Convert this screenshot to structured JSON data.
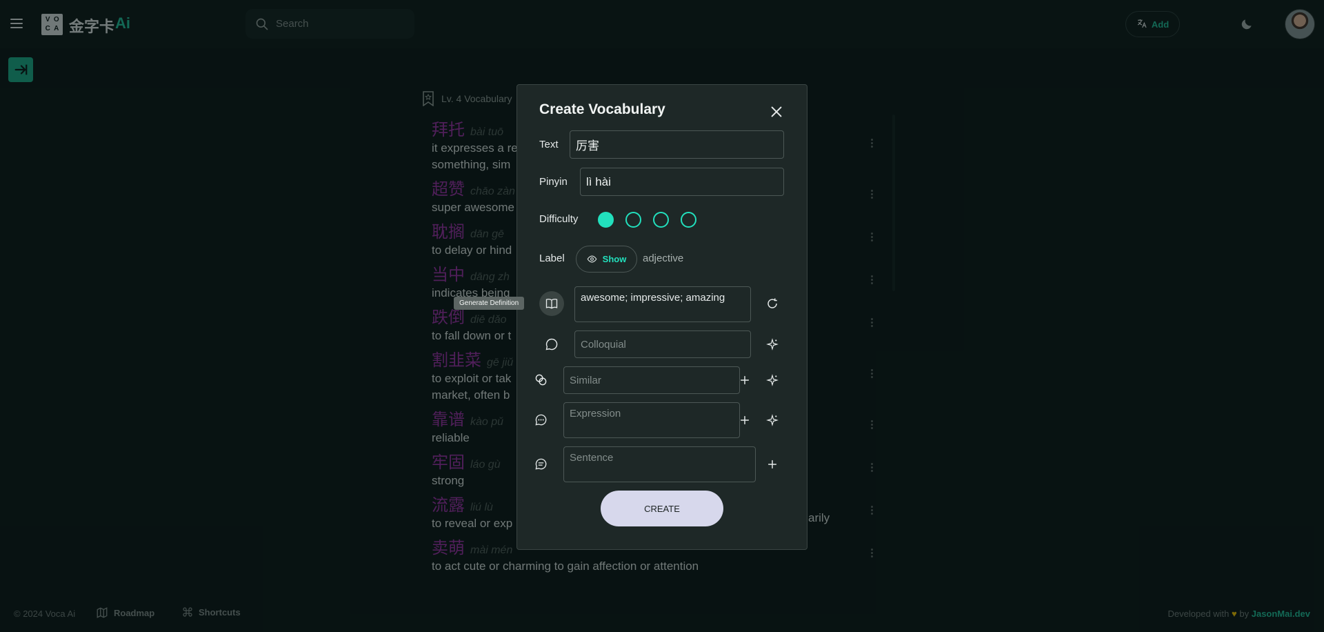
{
  "app": {
    "logo_letters": [
      "V",
      "O",
      "C",
      "A"
    ],
    "name": "金字卡",
    "name_suffix": "Ai"
  },
  "search": {
    "placeholder": "Search"
  },
  "header": {
    "add_label": "Add"
  },
  "level": {
    "label": "Lv. 4 Vocabulary"
  },
  "vocab": [
    {
      "hanzi": "拜托",
      "pinyin": "bài tuō",
      "definition": "it expresses a re",
      "definition2": "something, sim"
    },
    {
      "hanzi": "超赞",
      "pinyin": "chāo zàn",
      "definition": "super awesome"
    },
    {
      "hanzi": "耽搁",
      "pinyin": "dān gē",
      "definition": "to delay or hind"
    },
    {
      "hanzi": "当中",
      "pinyin": "dāng zh",
      "definition": "indicates being"
    },
    {
      "hanzi": "跌倒",
      "pinyin": "diē dǎo",
      "definition": "to fall down or t"
    },
    {
      "hanzi": "割韭菜",
      "pinyin": "gē jiǔ",
      "definition": "to exploit or tak",
      "definition2": "market, often b"
    },
    {
      "hanzi": "靠谱",
      "pinyin": "kào pǔ",
      "definition": "reliable"
    },
    {
      "hanzi": "牢固",
      "pinyin": "láo gù",
      "definition": "strong"
    },
    {
      "hanzi": "流露",
      "pinyin": "liú lù",
      "definition": "to reveal or exp",
      "definition_tail": "arily"
    },
    {
      "hanzi": "卖萌",
      "pinyin": "mài mén",
      "definition": "to act cute or charming to gain affection or attention"
    }
  ],
  "footer": {
    "copyright": "© 2024 Voca Ai",
    "roadmap": "Roadmap",
    "shortcuts": "Shortcuts",
    "developed_with": "Developed with",
    "heart": "♥",
    "by": "by",
    "author": "JasonMai.dev"
  },
  "modal": {
    "title": "Create Vocabulary",
    "text_label": "Text",
    "text_value": "厉害",
    "pinyin_label": "Pinyin",
    "pinyin_value": "lì hài",
    "difficulty_label": "Difficulty",
    "difficulty_level": 1,
    "difficulty_max": 4,
    "label_label": "Label",
    "show_label": "Show",
    "label_value": "adjective",
    "definition_value": "awesome; impressive; amazing",
    "tooltip": "Generate Definition",
    "colloquial_placeholder": "Colloquial",
    "similar_placeholder": "Similar",
    "expression_placeholder": "Expression",
    "sentence_placeholder": "Sentence",
    "create_label": "CREATE"
  },
  "colors": {
    "accent": "#1fb390",
    "radio": "#22e0bd",
    "hanzi": "#8e2f9a",
    "background": "#0b1716"
  },
  "icons": [
    "menu-icon",
    "search-icon",
    "translate-icon",
    "moon-icon",
    "arrow-right-icon",
    "bookmark-icon",
    "kebab-icon",
    "close-icon",
    "eye-icon",
    "book-icon",
    "refresh-icon",
    "chat-icon",
    "sparkle-icon",
    "link-icon",
    "plus-icon",
    "chat-dots-icon",
    "chat-lines-icon",
    "roadmap-icon",
    "shortcuts-icon"
  ]
}
